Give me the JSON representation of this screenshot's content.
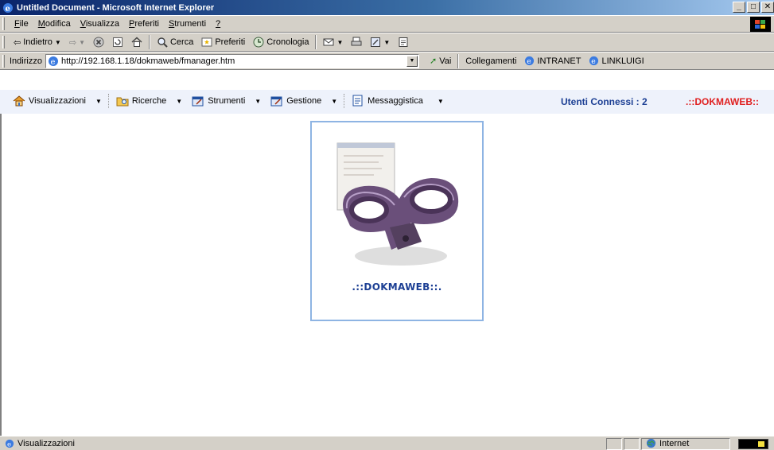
{
  "window": {
    "title": "Untitled Document - Microsoft Internet Explorer",
    "buttons": [
      "_",
      "□",
      "✕"
    ]
  },
  "menubar": {
    "items": [
      {
        "label": "File",
        "key": "F"
      },
      {
        "label": "Modifica",
        "key": "M"
      },
      {
        "label": "Visualizza",
        "key": "V"
      },
      {
        "label": "Preferiti",
        "key": "P"
      },
      {
        "label": "Strumenti",
        "key": "S"
      },
      {
        "label": "?",
        "key": "?"
      }
    ]
  },
  "toolbar": {
    "back": "Indietro",
    "search": "Cerca",
    "favorites": "Preferiti",
    "history": "Cronologia"
  },
  "address": {
    "label": "Indirizzo",
    "url": "http://192.168.1.18/dokmaweb/fmanager.htm",
    "go": "Vai",
    "links_label": "Collegamenti",
    "links": [
      "INTRANET",
      "LINKLUIGI"
    ]
  },
  "app": {
    "nav": [
      {
        "label": "Visualizzazioni",
        "icon": "home-icon"
      },
      {
        "label": "Ricerche",
        "icon": "folder-search-icon"
      },
      {
        "label": "Strumenti",
        "icon": "tools-icon"
      },
      {
        "label": "Gestione",
        "icon": "manage-icon"
      },
      {
        "label": "Messaggistica",
        "icon": "messages-icon"
      }
    ],
    "users_connected": "Utenti Connessi : 2",
    "brand": ".::DOKMAWEB::",
    "logo_caption": ".::DOKMAWEB::."
  },
  "status": {
    "text": "Visualizzazioni",
    "zone": "Internet"
  },
  "colors": {
    "accent_blue": "#1c3f94",
    "brand_red": "#e02020",
    "nav_bg": "#eef2fb",
    "logo_border": "#8eb4e3"
  }
}
